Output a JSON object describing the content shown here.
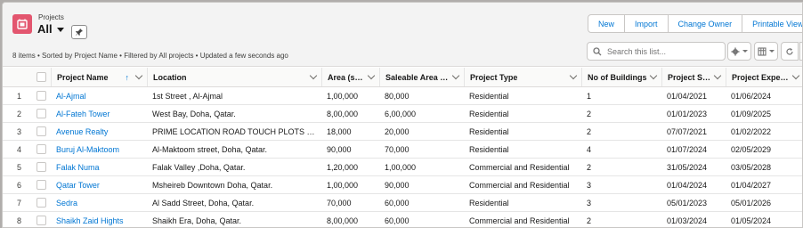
{
  "header": {
    "object_label": "Projects",
    "view_name": "All",
    "meta": "8 items • Sorted by Project Name • Filtered by All projects • Updated a few seconds ago",
    "accent": "#e3566f"
  },
  "actions": {
    "new": "New",
    "import": "Import",
    "change_owner": "Change Owner",
    "printable_view": "Printable View"
  },
  "search": {
    "placeholder": "Search this list..."
  },
  "columns": {
    "project_name": "Project Name",
    "location": "Location",
    "area": "Area (sqft)",
    "saleable": "Saleable Area (s...",
    "type": "Project Type",
    "buildings": "No of Buildings",
    "start": "Project Sta...",
    "expected": "Project Expecte..."
  },
  "rows": [
    {
      "n": "1",
      "name": "Al-Ajmal",
      "location": "1st Street , Al-Ajmal",
      "area": "1,00,000",
      "saleable": "80,000",
      "type": "Residential",
      "buildings": "1",
      "start": "01/04/2021",
      "expected": "01/06/2024"
    },
    {
      "n": "2",
      "name": "Al-Fateh Tower",
      "location": "West Bay, Doha, Qatar.",
      "area": "8,00,000",
      "saleable": "6,00,000",
      "type": "Residential",
      "buildings": "2",
      "start": "01/01/2023",
      "expected": "01/09/2025"
    },
    {
      "n": "3",
      "name": "Avenue Realty",
      "location": "PRIME LOCATION ROAD TOUCH PLOTS IN B...",
      "area": "18,000",
      "saleable": "20,000",
      "type": "Residential",
      "buildings": "2",
      "start": "07/07/2021",
      "expected": "01/02/2022"
    },
    {
      "n": "4",
      "name": "Buruj Al-Maktoom",
      "location": "Al-Maktoom street, Doha, Qatar.",
      "area": "90,000",
      "saleable": "70,000",
      "type": "Residential",
      "buildings": "4",
      "start": "01/07/2024",
      "expected": "02/05/2029"
    },
    {
      "n": "5",
      "name": "Falak Numa",
      "location": "Falak Valley ,Doha, Qatar.",
      "area": "1,20,000",
      "saleable": "1,00,000",
      "type": "Commercial and Residential",
      "buildings": "2",
      "start": "31/05/2024",
      "expected": "03/05/2028"
    },
    {
      "n": "6",
      "name": "Qatar Tower",
      "location": "Msheireb Downtown Doha, Qatar.",
      "area": "1,00,000",
      "saleable": "90,000",
      "type": "Commercial and Residential",
      "buildings": "3",
      "start": "01/04/2024",
      "expected": "01/04/2027"
    },
    {
      "n": "7",
      "name": "Sedra",
      "location": "Al Sadd Street, Doha, Qatar.",
      "area": "70,000",
      "saleable": "60,000",
      "type": "Residential",
      "buildings": "3",
      "start": "05/01/2023",
      "expected": "05/01/2026"
    },
    {
      "n": "8",
      "name": "Shaikh Zaid Hights",
      "location": "Shaikh Era, Doha, Qatar.",
      "area": "8,00,000",
      "saleable": "60,000",
      "type": "Commercial and Residential",
      "buildings": "2",
      "start": "01/03/2024",
      "expected": "01/05/2024"
    }
  ]
}
